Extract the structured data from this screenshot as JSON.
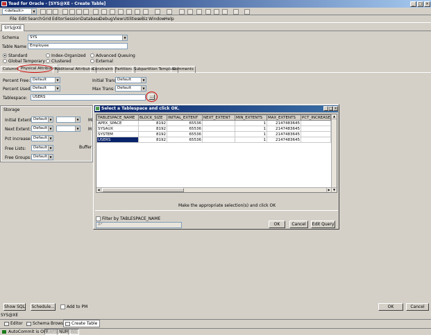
{
  "window": {
    "title": "Toad for Oracle - [SYS@XE - Create Table]"
  },
  "toolbar": {
    "connection": "<default>"
  },
  "menu": [
    "File",
    "Edit",
    "Search",
    "Grid",
    "Editor",
    "Session",
    "Database",
    "Debug",
    "View",
    "Utilities",
    "eBiz",
    "Window",
    "Help"
  ],
  "window_tab": "SYS@XE",
  "form": {
    "schema_label": "Schema",
    "schema_value": "SYS",
    "table_name_label": "Table Name",
    "table_name_value": "Employee",
    "radios": [
      "Standard",
      "Index-Organized",
      "Advanced Queuing",
      "Global Temporary",
      "Clustered",
      "External"
    ],
    "subtabs": [
      "Columns",
      "Physical Attributes",
      "Additional Attributes",
      "Constraints",
      "Partitions",
      "Subpartition Template",
      "Comments"
    ],
    "percent_free_label": "Percent Free:",
    "percent_free": "Default",
    "percent_used_label": "Percent Used:",
    "percent_used": "Default",
    "initial_trans_label": "Initial Trans:",
    "initial_trans": "Default",
    "max_trans_label": "Max Trans:",
    "max_trans": "Default",
    "tablespace_label": "Tablespace:",
    "tablespace_value": "USERS",
    "ellipsis": "...",
    "storage": {
      "title": "Storage",
      "initial_extent_label": "Initial Extent:",
      "initial_extent": "Default",
      "next_extent_label": "Next Extent:",
      "next_extent": "Default",
      "pct_increase_label": "Pct Increase:",
      "pct_increase": "Default",
      "free_lists_label": "Free Lists:",
      "free_lists": "Default",
      "free_groups_label": "Free Groups:",
      "free_groups": "Default",
      "mi": "Mi",
      "m": "M",
      "buffer_pool_label": "Buffer P"
    }
  },
  "dialog": {
    "title": "Select a Tablespace and click OK.",
    "columns": [
      "TABLESPACE_NAME",
      "BLOCK_SIZE",
      "INITIAL_EXTENT",
      "NEXT_EXTENT",
      "MIN_EXTENTS",
      "MAX_EXTENTS",
      "PCT_INCREASE"
    ],
    "rows": [
      [
        "APEX_SPACE",
        "8192",
        "65536",
        "",
        "1",
        "2147483645",
        ""
      ],
      [
        "SYSAUX",
        "8192",
        "65536",
        "",
        "1",
        "2147483645",
        ""
      ],
      [
        "SYSTEM",
        "8192",
        "65536",
        "",
        "1",
        "2147483645",
        ""
      ],
      [
        "USERS",
        "8192",
        "65536",
        "",
        "1",
        "2147483645",
        ""
      ]
    ],
    "hint": "Make the appropriate selection(s) and click OK",
    "filter_label": "Filter by TABLESPACE_NAME",
    "filter_value": "A*",
    "ok": "OK",
    "cancel": "Cancel",
    "edit_query": "Edit Query"
  },
  "footer": {
    "show_sql": "Show SQL",
    "schedule": "Schedule...",
    "add_to_pm": "Add to PM",
    "ok": "OK",
    "cancel": "Cancel",
    "conn_label": "SYS@XE"
  },
  "bottom_tabs": [
    "Editor",
    "Schema Browser",
    "Create Table"
  ],
  "status": {
    "autocommit": "AutoCommit is OFF",
    "caps": "CAPS",
    "num": "NUM",
    "ins": "INS"
  }
}
